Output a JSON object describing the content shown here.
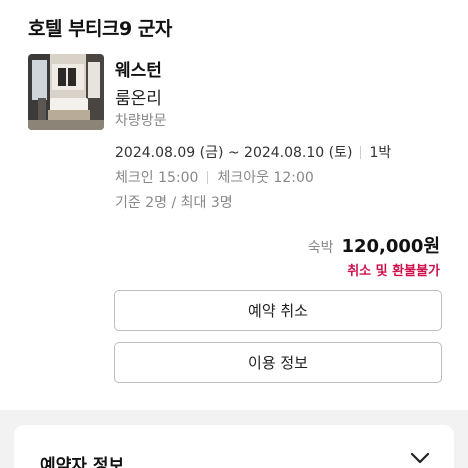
{
  "hotel": {
    "title": "호텔 부티크9 군자"
  },
  "room": {
    "name": "웨스턴",
    "type": "룸온리",
    "option": "차량방문",
    "thumbnail_icon": "hotel-room-photo"
  },
  "stay": {
    "dates": "2024.08.09 (금) ~ 2024.08.10 (토)",
    "nights": "1박",
    "checkin": "체크인 15:00",
    "checkout": "체크아웃 12:00",
    "capacity": "기준 2명 / 최대 3명"
  },
  "price": {
    "label": "숙박",
    "value": "120,000원",
    "refund_note": "취소 및 환불불가",
    "refund_color": "#d0124c"
  },
  "actions": {
    "cancel_label": "예약 취소",
    "info_label": "이용 정보"
  },
  "booker_section": {
    "title": "예약자 정보",
    "toggle_icon": "chevron-down-icon"
  }
}
